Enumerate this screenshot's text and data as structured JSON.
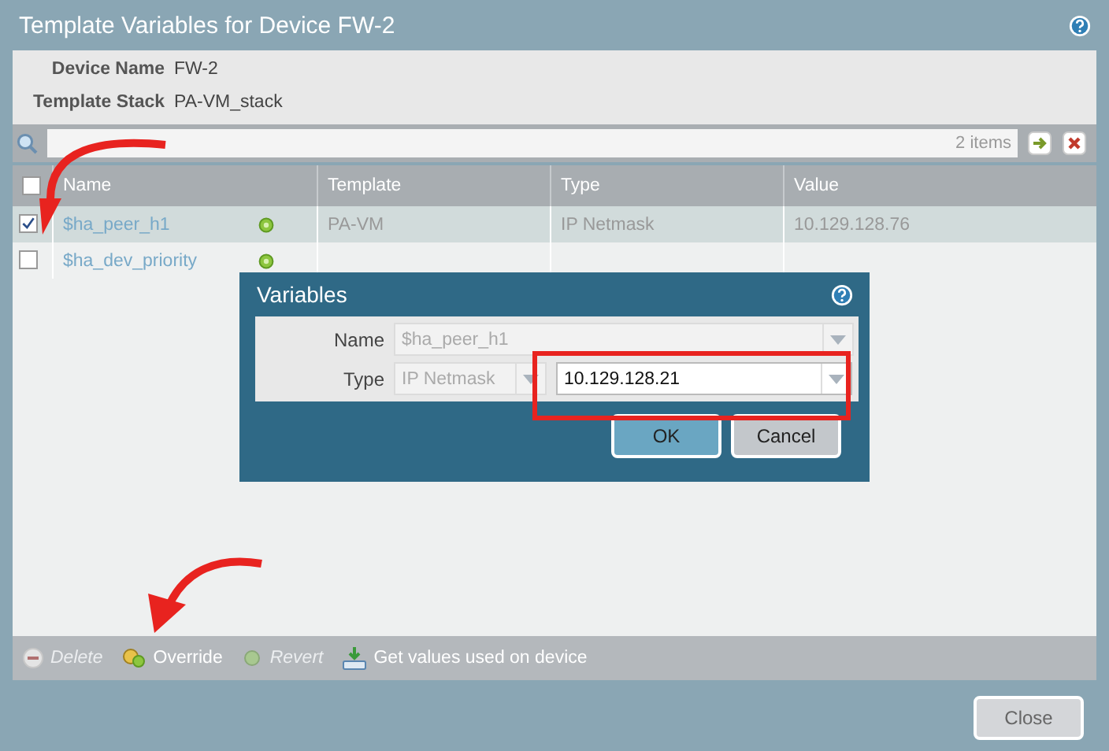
{
  "window": {
    "title": "Template Variables for Device FW-2"
  },
  "info": [
    {
      "label": "Device Name",
      "value": "FW-2"
    },
    {
      "label": "Template Stack",
      "value": "PA-VM_stack"
    }
  ],
  "search": {
    "count": "2 items"
  },
  "table": {
    "all_checked": false,
    "columns": [
      "Name",
      "Template",
      "Type",
      "Value"
    ],
    "rows": [
      {
        "name": "$ha_peer_h1",
        "template": "PA-VM",
        "type": "IP Netmask",
        "value": "10.129.128.76",
        "checked": true,
        "selected": true
      },
      {
        "name": "$ha_dev_priority",
        "checked": false,
        "selected": false
      }
    ]
  },
  "toolbar": [
    {
      "label": "Delete",
      "kind": "delete",
      "disabled": true
    },
    {
      "label": "Override",
      "kind": "override",
      "disabled": false
    },
    {
      "label": "Revert",
      "kind": "revert",
      "disabled": true
    },
    {
      "label": "Get values used on device",
      "kind": "fetch",
      "disabled": false
    }
  ],
  "close_button": "Close",
  "dialog": {
    "title": "Variables",
    "name_label": "Name",
    "name_value": "$ha_peer_h1",
    "type_label": "Type",
    "type_value": "IP Netmask",
    "value": "10.129.128.21",
    "buttons": [
      "OK",
      "Cancel"
    ]
  }
}
